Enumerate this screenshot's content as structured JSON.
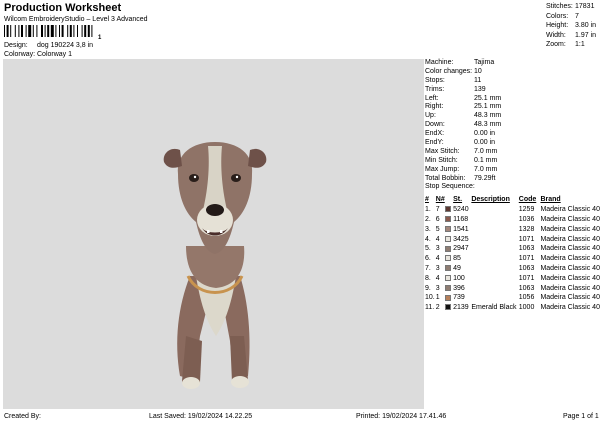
{
  "header": {
    "title": "Production Worksheet",
    "subtitle": "Wilcom EmbroideryStudio – Level 3 Advanced",
    "barcode_number": "1"
  },
  "design": {
    "label": "Design:",
    "value": "dog 190224 3,8 in"
  },
  "colorway": {
    "label": "Colorway:",
    "value": "Colorway 1"
  },
  "stats": [
    {
      "label": "Stitches:",
      "value": "17831"
    },
    {
      "label": "Colors:",
      "value": "7"
    },
    {
      "label": "Height:",
      "value": "3.80 in"
    },
    {
      "label": "Width:",
      "value": "1.97 in"
    },
    {
      "label": "Zoom:",
      "value": "1:1"
    }
  ],
  "machine_info": [
    {
      "label": "Machine:",
      "value": "Tajima"
    },
    {
      "label": "Color changes:",
      "value": "10"
    },
    {
      "label": "Stops:",
      "value": "11"
    },
    {
      "label": "Trims:",
      "value": "139"
    },
    {
      "label": "Left:",
      "value": "25.1 mm"
    },
    {
      "label": "Right:",
      "value": "25.1 mm"
    },
    {
      "label": "Up:",
      "value": "48.3 mm"
    },
    {
      "label": "Down:",
      "value": "48.3 mm"
    },
    {
      "label": "EndX:",
      "value": "0.00 in"
    },
    {
      "label": "EndY:",
      "value": "0.00 in"
    },
    {
      "label": "Max Stitch:",
      "value": "7.0 mm"
    },
    {
      "label": "Min Stitch:",
      "value": "0.1 mm"
    },
    {
      "label": "Max Jump:",
      "value": "7.0 mm"
    },
    {
      "label": "Total Bobbin:",
      "value": "79.29ft"
    }
  ],
  "stop_sequence": {
    "title": "Stop Sequence:",
    "headers": {
      "num": "#",
      "n": "N#",
      "st": "St.",
      "description": "Description",
      "code": "Code",
      "brand": "Brand"
    },
    "rows": [
      {
        "num": "1.",
        "n": "7",
        "color": "#5e3a33",
        "st": "5240",
        "description": "",
        "code": "1259",
        "brand": "Madeira Classic 40"
      },
      {
        "num": "2.",
        "n": "6",
        "color": "#8a5a4e",
        "st": "1168",
        "description": "",
        "code": "1036",
        "brand": "Madeira Classic 40"
      },
      {
        "num": "3.",
        "n": "5",
        "color": "#a3877c",
        "st": "1541",
        "description": "",
        "code": "1328",
        "brand": "Madeira Classic 40"
      },
      {
        "num": "4.",
        "n": "4",
        "color": "#e9e6de",
        "st": "3425",
        "description": "",
        "code": "1071",
        "brand": "Madeira Classic 40"
      },
      {
        "num": "5.",
        "n": "3",
        "color": "#8f7d73",
        "st": "2947",
        "description": "",
        "code": "1063",
        "brand": "Madeira Classic 40"
      },
      {
        "num": "6.",
        "n": "4",
        "color": "#e9e6de",
        "st": "85",
        "description": "",
        "code": "1071",
        "brand": "Madeira Classic 40"
      },
      {
        "num": "7.",
        "n": "3",
        "color": "#8f7d73",
        "st": "49",
        "description": "",
        "code": "1063",
        "brand": "Madeira Classic 40"
      },
      {
        "num": "8.",
        "n": "4",
        "color": "#e9e6de",
        "st": "100",
        "description": "",
        "code": "1071",
        "brand": "Madeira Classic 40"
      },
      {
        "num": "9.",
        "n": "3",
        "color": "#8f7d73",
        "st": "396",
        "description": "",
        "code": "1063",
        "brand": "Madeira Classic 40"
      },
      {
        "num": "10.",
        "n": "1",
        "color": "#b57f5a",
        "st": "739",
        "description": "",
        "code": "1056",
        "brand": "Madeira Classic 40"
      },
      {
        "num": "11.",
        "n": "2",
        "color": "#111111",
        "st": "2139",
        "description": "Emerald Black",
        "code": "1000",
        "brand": "Madeira Classic 40"
      }
    ]
  },
  "footer": {
    "created_by": "Created By:",
    "last_saved": "Last Saved: 19/02/2024 14.22.25",
    "printed": "Printed: 19/02/2024 17.41.46",
    "page": "Page 1 of 1"
  }
}
